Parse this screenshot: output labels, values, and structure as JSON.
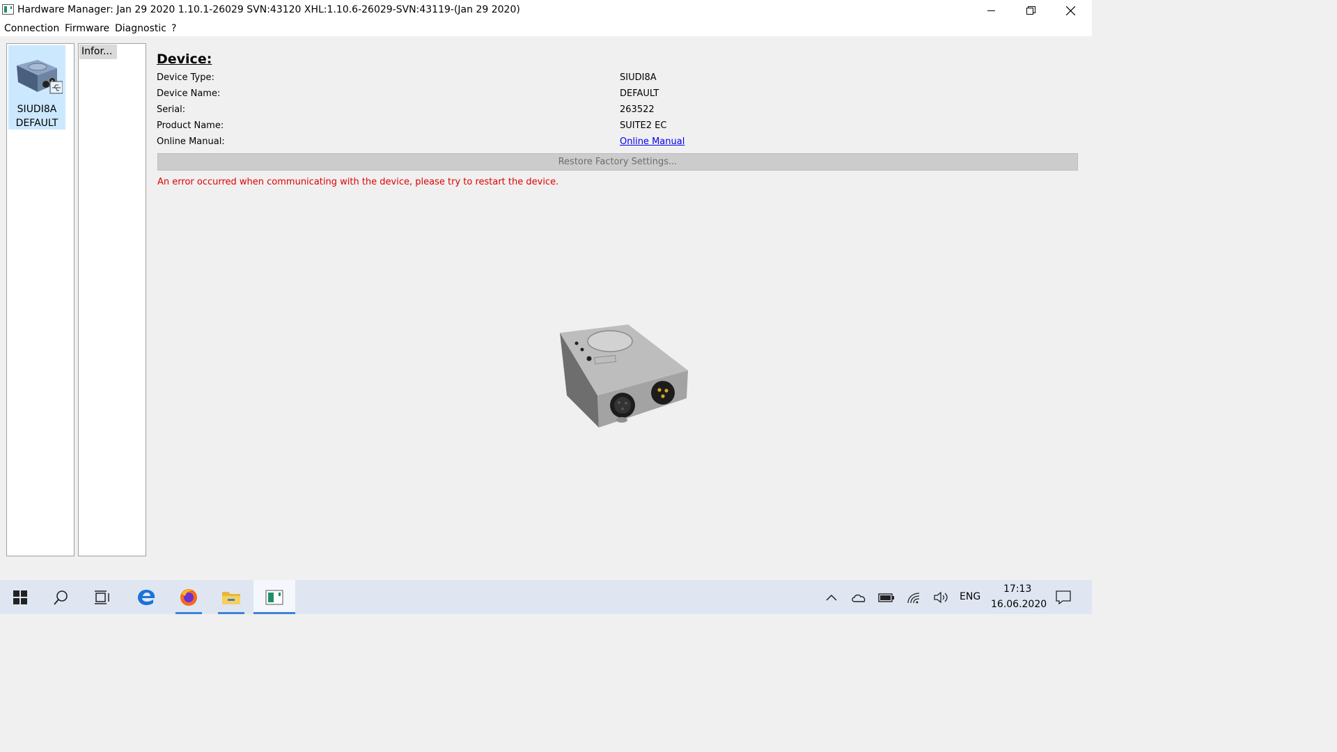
{
  "window": {
    "title": "Hardware Manager: Jan 29 2020 1.10.1-26029 SVN:43120 XHL:1.10.6-26029-SVN:43119-(Jan 29 2020)",
    "controls": [
      "minimize-icon",
      "restore-icon",
      "close-icon"
    ]
  },
  "menu": {
    "items": [
      "Connection",
      "Firmware",
      "Diagnostic",
      "?"
    ]
  },
  "device_list": {
    "items": [
      {
        "name": "SIUDI8A",
        "sub": "DEFAULT",
        "icon": "interface-box-icon",
        "selected": true
      }
    ]
  },
  "tabs": {
    "items": [
      "Infor..."
    ]
  },
  "device": {
    "heading": "Device:",
    "fields": [
      {
        "label": "Device Type:",
        "value": "SIUDI8A"
      },
      {
        "label": "Device Name:",
        "value": "DEFAULT"
      },
      {
        "label": "Serial:",
        "value": "263522"
      },
      {
        "label": "Product Name:",
        "value": "SUITE2 EC"
      },
      {
        "label": "Online Manual:",
        "value": "Online Manual",
        "is_link": true
      }
    ],
    "restore_button": "Restore Factory Settings...",
    "error_message": "An error occurred when communicating with the device, please try to restart the device."
  },
  "taskbar": {
    "apps": [
      "start-icon",
      "search-icon",
      "task-view-icon",
      "edge-icon",
      "firefox-icon",
      "file-explorer-icon",
      "hardware-manager-icon"
    ],
    "tray": {
      "language": "ENG",
      "time": "17:13",
      "date": "16.06.2020"
    }
  },
  "colors": {
    "selection": "#cce8ff",
    "error": "#e00000",
    "link": "#0000ee",
    "taskbar": "#dfe6f2",
    "taskbar_accent": "#3c82d8"
  }
}
